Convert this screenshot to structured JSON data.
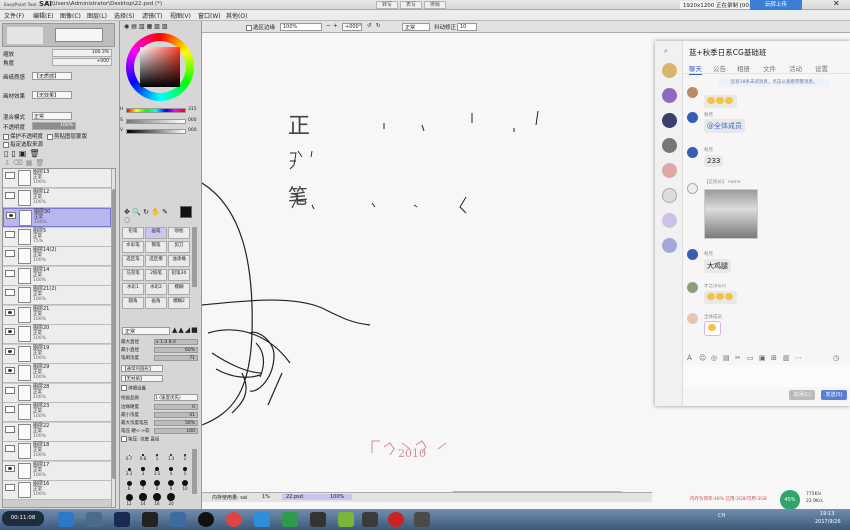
{
  "titlebar": {
    "app": "SAI",
    "logo_prefix": "EasyPaint Tool",
    "path": "C:\\Users\\Administrator\\Desktop\\22.psd (*)",
    "nav_buttons": [
      "转写",
      "表写",
      "排版"
    ],
    "record_text": "1920x1200 正在录制 [00:06:14]",
    "live_button": "玩转上传"
  },
  "menu": [
    "文件(F)",
    "编辑(E)",
    "图像(C)",
    "图层(L)",
    "选择(S)",
    "滤镜(T)",
    "视图(V)",
    "窗口(W)",
    "其他(O)"
  ],
  "left": {
    "zoom_label": "缩放",
    "zoom_value": "100.3%",
    "angle_label": "角度",
    "angle_value": "+000",
    "paper_texture_label": "画纸质感",
    "paper_texture_value": "【无质感】",
    "paper_effect_label": "画材效果",
    "paper_effect_value": "【无效果】",
    "mix_mode_label": "混合模式",
    "mix_mode_value": "正常",
    "opacity_label": "不透明度",
    "opacity_value": "100%",
    "protect_opacity": "保护不透明度",
    "clip_group": "剪贴图层蒙版",
    "designate_source": "指定选取来源"
  },
  "layers": [
    {
      "name": "图层13",
      "mode": "正常",
      "opacity": "100%",
      "visible": false,
      "selected": false
    },
    {
      "name": "图层12",
      "mode": "正常",
      "opacity": "100%",
      "visible": false,
      "selected": false
    },
    {
      "name": "图层30",
      "mode": "正常",
      "opacity": "100%",
      "visible": true,
      "selected": true
    },
    {
      "name": "图层5",
      "mode": "正常",
      "opacity": "75%",
      "visible": false,
      "selected": false
    },
    {
      "name": "图层14(2)",
      "mode": "正常",
      "opacity": "100%",
      "visible": false,
      "selected": false
    },
    {
      "name": "图层14",
      "mode": "正常",
      "opacity": "100%",
      "visible": false,
      "selected": false
    },
    {
      "name": "图层21(2)",
      "mode": "正常",
      "opacity": "100%",
      "visible": false,
      "selected": false
    },
    {
      "name": "图层21",
      "mode": "正常",
      "opacity": "100%",
      "visible": true,
      "selected": false
    },
    {
      "name": "图层20",
      "mode": "正常",
      "opacity": "100%",
      "visible": true,
      "selected": false
    },
    {
      "name": "图层19",
      "mode": "正常",
      "opacity": "100%",
      "visible": true,
      "selected": false
    },
    {
      "name": "图层29",
      "mode": "正常",
      "opacity": "100%",
      "visible": true,
      "selected": false
    },
    {
      "name": "图层28",
      "mode": "正常",
      "opacity": "100%",
      "visible": false,
      "selected": false
    },
    {
      "name": "图层23",
      "mode": "正常",
      "opacity": "100%",
      "visible": false,
      "selected": false
    },
    {
      "name": "图层22",
      "mode": "正常",
      "opacity": "100%",
      "visible": false,
      "selected": false
    },
    {
      "name": "图层18",
      "mode": "正常",
      "opacity": "100%",
      "visible": false,
      "selected": false
    },
    {
      "name": "图层17",
      "mode": "正常",
      "opacity": "100%",
      "visible": true,
      "selected": false
    },
    {
      "name": "图层16",
      "mode": "正常",
      "opacity": "100%",
      "visible": false,
      "selected": false
    }
  ],
  "color": {
    "h_value": "315",
    "s_value": "000",
    "v_value": "000",
    "h_label": "H",
    "s_label": "S",
    "v_label": "V",
    "swatch": "#111111"
  },
  "tools": [
    {
      "label": "铅笔",
      "selected": false
    },
    {
      "label": "画笔",
      "selected": true
    },
    {
      "label": "喷枪",
      "selected": false
    },
    {
      "label": "水彩笔",
      "selected": false
    },
    {
      "label": "钢笔",
      "selected": false
    },
    {
      "label": "剪刀",
      "selected": false
    },
    {
      "label": "选区笔",
      "selected": false
    },
    {
      "label": "选区擦",
      "selected": false
    },
    {
      "label": "油漆桶",
      "selected": false
    },
    {
      "label": "马克笔",
      "selected": false
    },
    {
      "label": "2值笔",
      "selected": false
    },
    {
      "label": "铅笔30",
      "selected": false
    },
    {
      "label": "水彩1",
      "selected": false
    },
    {
      "label": "水彩2",
      "selected": false
    },
    {
      "label": "模糊",
      "selected": false
    },
    {
      "label": "圆角",
      "selected": false
    },
    {
      "label": "画角",
      "selected": false
    },
    {
      "label": "模糊2",
      "selected": false
    }
  ],
  "brush": {
    "mode": "正常",
    "max_size_label": "最大直径",
    "max_size_value": "x 1.0   8.0",
    "min_size_label": "最小直径",
    "min_size_value": "60%",
    "density_label": "笔刷浓度",
    "density_value": "71",
    "shape_value": "【通常的圆形】",
    "texture_value": "【无材质】",
    "detail_label": "详细设置",
    "quality_label": "绘画品质",
    "quality_value": "1 (速度优先)",
    "edge_label": "边缘硬度",
    "edge_value": "0",
    "min_density_label": "最小浓度",
    "min_density_value": "41",
    "max_pressure_label": "最大浓度笔压",
    "max_pressure_value": "56%",
    "pressure_label": "笔压 硬<->软",
    "pressure_value": "100",
    "pressure_check": "笔压: 浓度 直径",
    "sizes": [
      "0.7",
      "0.8",
      "1",
      "1.3",
      "2",
      "2.3",
      "3",
      "3.5",
      "4",
      "5",
      "6",
      "7",
      "8",
      "9",
      "10",
      "12",
      "14",
      "16",
      "20"
    ]
  },
  "canvas_toolbar": {
    "antialias": "选区边缘",
    "zoom": "100%",
    "angle": "+000°",
    "mode": "正常",
    "stabilizer_label": "抖动修正",
    "stabilizer_value": "10"
  },
  "canvas_marks": [
    "正",
    "笔",
    "2010"
  ],
  "status": {
    "memory": "内存使用量: sai",
    "memory_value": "1%",
    "file_tab": "22.psd",
    "file_zoom": "100%"
  },
  "qq": {
    "title": "蓝+秋季日系CG基础班",
    "tabs": [
      "聊天",
      "公告",
      "相册",
      "文件",
      "活动",
      "设置"
    ],
    "notice": "您有18条未读消息，点击以查看完整消息。",
    "messages": [
      {
        "name": "",
        "text": "😂😂😂",
        "type": "emoji"
      },
      {
        "name": "秋月",
        "text": "@全体成员",
        "type": "blue"
      },
      {
        "name": "秋月",
        "text": "233",
        "type": "text"
      },
      {
        "name": "【正校长】 name",
        "text": "",
        "type": "image"
      },
      {
        "name": "秋月",
        "text": "大鸡腿",
        "type": "text"
      },
      {
        "name": "才之(blyn)",
        "text": "😂😂😂",
        "type": "emoji"
      },
      {
        "name": "全体成员",
        "text": "😊",
        "type": "emoji"
      }
    ],
    "close_button": "关闭(C)",
    "send_button": "发送(S)",
    "accent": "#2f5fbf"
  },
  "taskbar": {
    "start": "00:11:08",
    "clock_time": "19:13",
    "clock_date": "2017/9/26",
    "tray_text": "CH",
    "speed_up": "775K/s",
    "speed_down": "22.9K/s",
    "cpu": "45%",
    "watermark": "内存负荷率:48% 已用:3GB/可用:3GB"
  }
}
